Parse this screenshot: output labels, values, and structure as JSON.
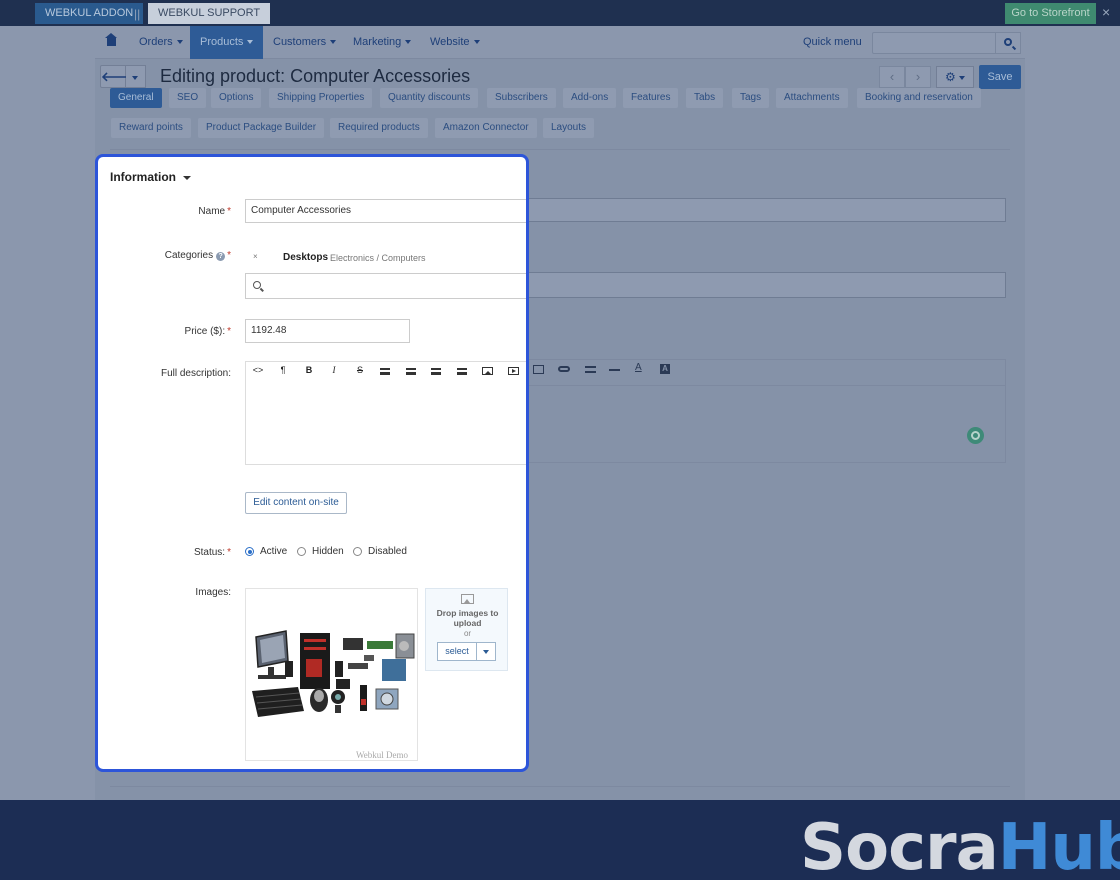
{
  "topbar": {
    "addon": "WEBKUL ADDON",
    "separator": "||",
    "support": "WEBKUL SUPPORT",
    "storefront": "Go to Storefront",
    "close": "×"
  },
  "nav": {
    "items": [
      {
        "label": "Orders"
      },
      {
        "label": "Products"
      },
      {
        "label": "Customers"
      },
      {
        "label": "Marketing"
      },
      {
        "label": "Website"
      }
    ],
    "quick_menu": "Quick menu"
  },
  "header": {
    "back": "🡐",
    "title": "Editing product: Computer Accessories",
    "prev": "‹",
    "next": "›",
    "gear": "⚙",
    "save": "Save"
  },
  "tabs": [
    {
      "label": "General",
      "active": true
    },
    {
      "label": "SEO"
    },
    {
      "label": "Options"
    },
    {
      "label": "Shipping Properties"
    },
    {
      "label": "Quantity discounts"
    },
    {
      "label": "Subscribers"
    },
    {
      "label": "Add-ons"
    },
    {
      "label": "Features"
    },
    {
      "label": "Tabs"
    },
    {
      "label": "Tags"
    },
    {
      "label": "Attachments"
    },
    {
      "label": "Booking and reservation"
    },
    {
      "label": "Reward points"
    },
    {
      "label": "Product Package Builder"
    },
    {
      "label": "Required products"
    },
    {
      "label": "Amazon Connector"
    },
    {
      "label": "Layouts"
    }
  ],
  "form": {
    "section_title": "Information",
    "name_label": "Name",
    "name_value": "Computer Accessories",
    "categories_label": "Categories",
    "category": {
      "remove": "×",
      "name": "Desktops",
      "path": "Electronics / Computers"
    },
    "price_label": "Price ($):",
    "price_value": "1192.48",
    "description_label": "Full description:",
    "toolbar": {
      "code": "<>",
      "paragraph": "¶",
      "bold": "B",
      "italic": "I",
      "strike": "S",
      "font_color": "A",
      "bg_color": "A"
    },
    "edit_onsite": "Edit content on-site",
    "status_label": "Status:",
    "status_options": [
      {
        "label": "Active",
        "selected": true
      },
      {
        "label": "Hidden"
      },
      {
        "label": "Disabled"
      }
    ],
    "images_label": "Images:",
    "watermark": "Webkul Demo",
    "drop_text": "Drop images to upload",
    "drop_or": "or",
    "select_label": "select",
    "required_mark": "*"
  },
  "brand": {
    "part1": "Socra",
    "part2": "Hub"
  },
  "colors": {
    "accent": "#2e5b96",
    "highlight_border": "#2d55d9",
    "footer": "#1c2d54"
  }
}
